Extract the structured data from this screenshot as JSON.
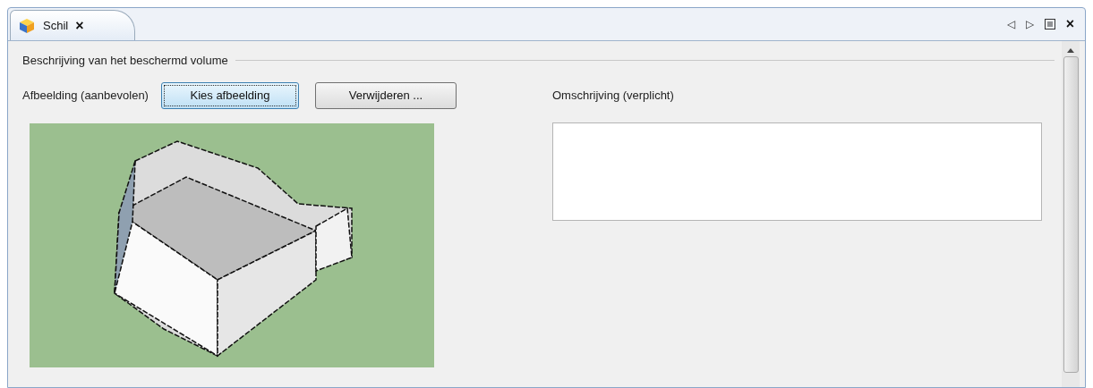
{
  "tabs": [
    {
      "label": "Schil",
      "selected": true,
      "close": "×"
    }
  ],
  "tab_controls": [
    "◁",
    "▷",
    "×"
  ],
  "group": {
    "title": "Beschrijving van het beschermd volume"
  },
  "image_section": {
    "label": "Afbeelding (aanbevolen)",
    "buttons": [
      {
        "label": "Kies afbeelding",
        "focused": true
      },
      {
        "label": "Verwijderen ...",
        "focused": false
      }
    ]
  },
  "description": {
    "label": "Omschrijving (verplicht)"
  }
}
